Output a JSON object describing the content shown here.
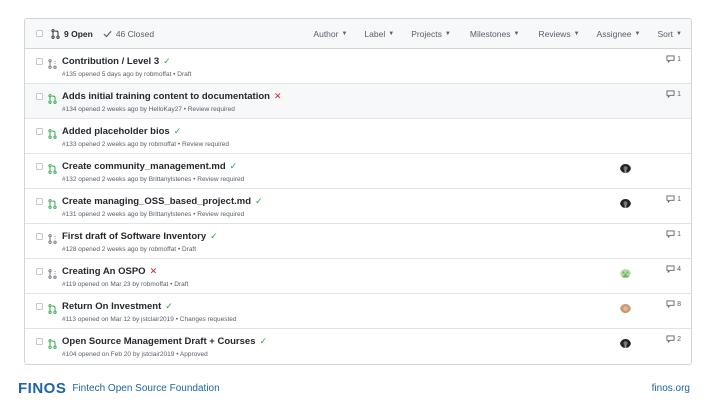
{
  "header": {
    "open_count": "9 Open",
    "closed_count": "46 Closed",
    "filters": [
      "Author",
      "Label",
      "Projects",
      "Milestones",
      "Reviews",
      "Assignee",
      "Sort"
    ]
  },
  "pulls": [
    {
      "title": "Contribution / Level 3",
      "status": "success",
      "meta": "#135 opened 5 days ago by robmoffat • Draft",
      "draft": true,
      "comments": "1",
      "avatar": null,
      "highlight": false
    },
    {
      "title": "Adds initial training content to documentation",
      "status": "failure",
      "meta": "#134 opened 2 weeks ago by HelloKay27 • Review required",
      "draft": false,
      "comments": "1",
      "avatar": null,
      "highlight": true
    },
    {
      "title": "Added placeholder bios",
      "status": "success",
      "meta": "#133 opened 2 weeks ago by robmoffat • Review required",
      "draft": false,
      "comments": "",
      "avatar": null,
      "highlight": false
    },
    {
      "title": "Create community_management.md",
      "status": "success",
      "meta": "#132 opened 2 weeks ago by Brittanylstenes • Review required",
      "draft": false,
      "comments": "",
      "avatar": "dark",
      "highlight": false
    },
    {
      "title": "Create managing_OSS_based_project.md",
      "status": "success",
      "meta": "#131 opened 2 weeks ago by Brittanylstenes • Review required",
      "draft": false,
      "comments": "1",
      "avatar": "dark",
      "highlight": false
    },
    {
      "title": "First draft of Software Inventory",
      "status": "success",
      "meta": "#128 opened 2 weeks ago by robmoffat • Draft",
      "draft": true,
      "comments": "1",
      "avatar": null,
      "highlight": false
    },
    {
      "title": "Creating An OSPO",
      "status": "failure",
      "meta": "#119 opened on Mar 23 by robmoffat • Draft",
      "draft": true,
      "comments": "4",
      "avatar": "green",
      "highlight": false
    },
    {
      "title": "Return On Investment",
      "status": "success",
      "meta": "#113 opened on Mar 12 by jstclair2019 • Changes requested",
      "draft": false,
      "comments": "8",
      "avatar": "photo",
      "highlight": false
    },
    {
      "title": "Open Source Management Draft + Courses",
      "status": "success",
      "meta": "#104 opened on Feb 20 by jstclair2019 • Approved",
      "draft": false,
      "comments": "2",
      "avatar": "dark",
      "highlight": false
    }
  ],
  "footer": {
    "brand": "FINOS",
    "brand_name": "Fintech Open Source Foundation",
    "site": "finos.org"
  },
  "colors": {
    "open_icon": "#28a745",
    "draft_icon": "#6a737d",
    "success": "#28a745",
    "failure": "#cb2431",
    "brand": "#1c63a8"
  },
  "icons": {
    "pr_open": "git-pull-request-icon",
    "pr_draft": "git-pull-request-draft-icon",
    "success": "check-icon",
    "failure": "x-icon",
    "comment": "comment-icon",
    "closed": "check-icon"
  }
}
